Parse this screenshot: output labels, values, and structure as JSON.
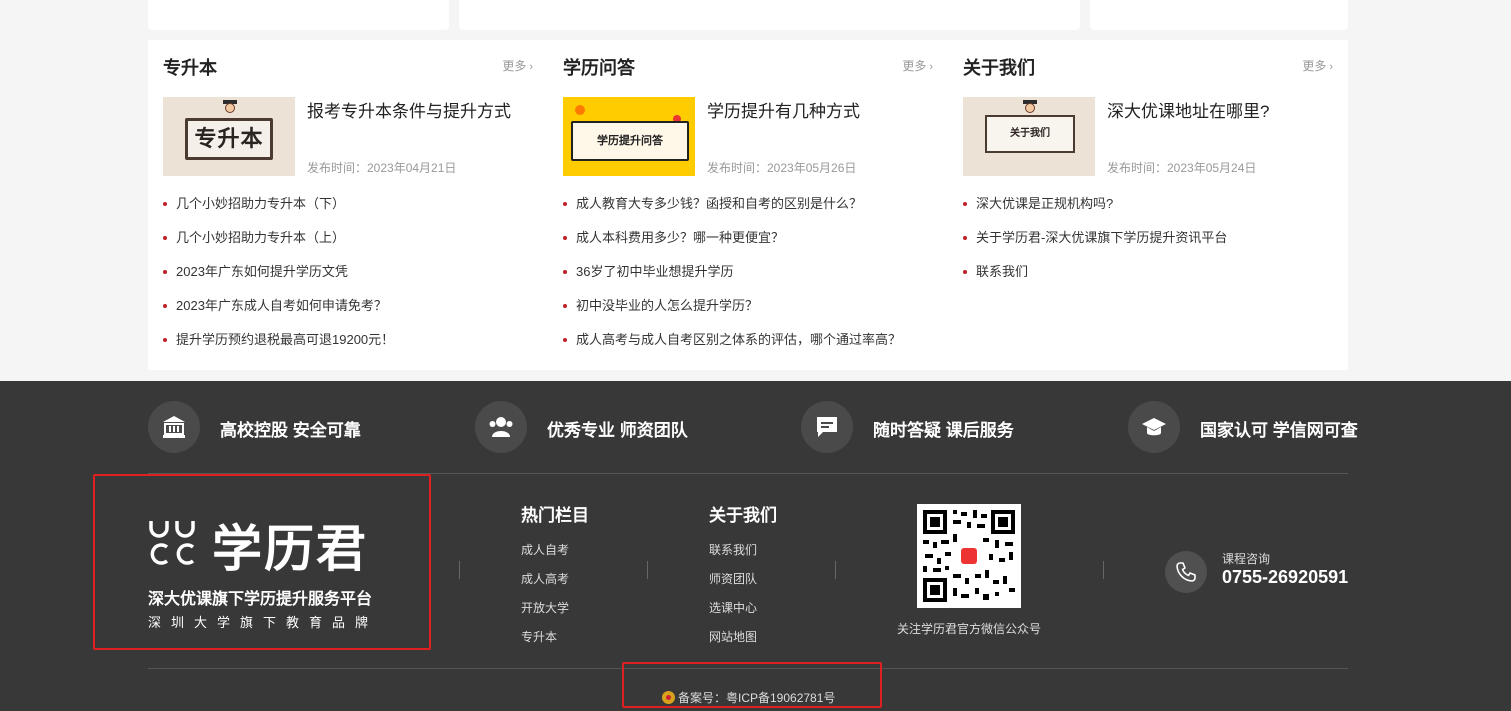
{
  "columns": [
    {
      "title": "专升本",
      "more": "更多",
      "featured": {
        "title": "报考专升本条件与提升方式",
        "date": "发布时间：2023年04月21日",
        "thumb_text": "专升本"
      },
      "items": [
        "几个小妙招助力专升本（下）",
        "几个小妙招助力专升本（上）",
        "2023年广东如何提升学历文凭",
        "2023年广东成人自考如何申请免考？",
        "提升学历预约退税最高可退19200元！"
      ]
    },
    {
      "title": "学历问答",
      "more": "更多",
      "featured": {
        "title": "学历提升有几种方式",
        "date": "发布时间：2023年05月26日",
        "thumb_text": "学历提升问答"
      },
      "items": [
        "成人教育大专多少钱？函授和自考的区别是什么？",
        "成人本科费用多少？哪一种更便宜？",
        "36岁了初中毕业想提升学历",
        "初中没毕业的人怎么提升学历？",
        "成人高考与成人自考区别之体系的评估，哪个通过率高？"
      ]
    },
    {
      "title": "关于我们",
      "more": "更多",
      "featured": {
        "title": "深大优课地址在哪里?",
        "date": "发布时间：2023年05月24日",
        "thumb_text": "关于我们"
      },
      "items": [
        "深大优课是正规机构吗?",
        "关于学历君-深大优课旗下学历提升资讯平台",
        "联系我们"
      ]
    }
  ],
  "footer": {
    "features": [
      "高校控股 安全可靠",
      "优秀专业 师资团队",
      "随时答疑 课后服务",
      "国家认可 学信网可查"
    ],
    "brand": {
      "name": "学历君",
      "sub1": "深大优课旗下学历提升服务平台",
      "sub2": "深圳大学旗下教育品牌"
    },
    "hot": {
      "title": "热门栏目",
      "links": [
        "成人自考",
        "成人高考",
        "开放大学",
        "专升本"
      ]
    },
    "about": {
      "title": "关于我们",
      "links": [
        "联系我们",
        "师资团队",
        "选课中心",
        "网站地图"
      ]
    },
    "qr_caption": "关注学历君官方微信公众号",
    "phone_label": "课程咨询",
    "phone": "0755-26920591",
    "icp": "备案号：粤ICP备19062781号"
  },
  "colors": {
    "accent": "#c0202a",
    "footer_bg": "#383838",
    "highlight": "#e02020"
  }
}
